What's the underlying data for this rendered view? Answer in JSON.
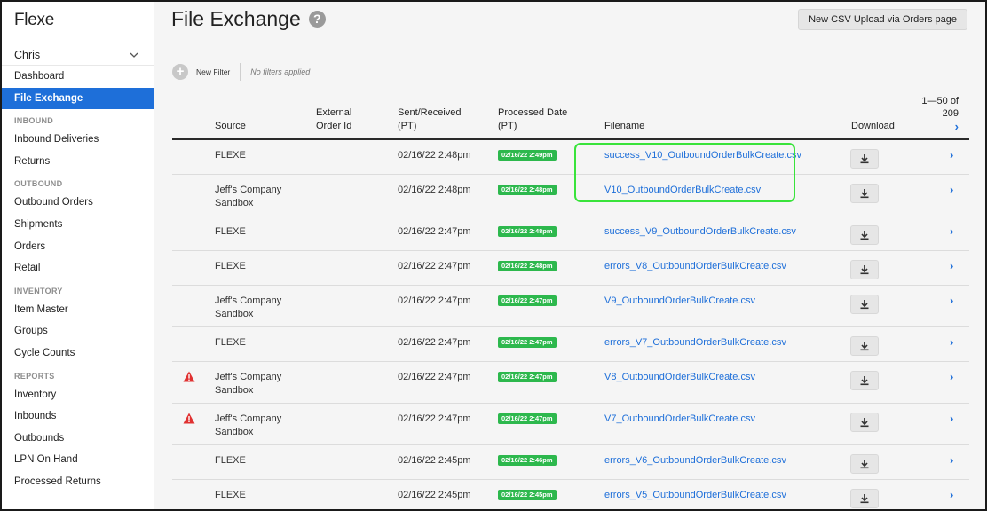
{
  "app": {
    "logo": "Flexe",
    "user": "Chris"
  },
  "sidebar": {
    "top_items": [
      {
        "label": "Dashboard",
        "active": false
      },
      {
        "label": "File Exchange",
        "active": true
      }
    ],
    "sections": [
      {
        "title": "INBOUND",
        "items": [
          "Inbound Deliveries",
          "Returns"
        ]
      },
      {
        "title": "OUTBOUND",
        "items": [
          "Outbound Orders",
          "Shipments",
          "Orders",
          "Retail"
        ]
      },
      {
        "title": "INVENTORY",
        "items": [
          "Item Master",
          "Groups",
          "Cycle Counts"
        ]
      },
      {
        "title": "REPORTS",
        "items": [
          "Inventory",
          "Inbounds",
          "Outbounds",
          "LPN On Hand",
          "Processed Returns"
        ]
      }
    ]
  },
  "header": {
    "title": "File Exchange",
    "help": "?",
    "upload_button": "New CSV Upload via Orders page"
  },
  "filters": {
    "new_filter": "New Filter",
    "status": "No filters applied"
  },
  "table": {
    "columns": {
      "source": "Source",
      "external_order_id": "External Order Id",
      "sent_received": "Sent/Received (PT)",
      "processed_date": "Processed Date (PT)",
      "filename": "Filename",
      "download": "Download"
    },
    "pager": {
      "range": "1—50 of",
      "total": "209",
      "next": "›"
    },
    "rows": [
      {
        "source": "FLEXE",
        "sent": "02/16/22 2:48pm",
        "processed": "02/16/22 2:49pm",
        "filename": "success_V10_OutboundOrderBulkCreate.csv",
        "warning": false
      },
      {
        "source": "Jeff's Company Sandbox",
        "sent": "02/16/22 2:48pm",
        "processed": "02/16/22 2:48pm",
        "filename": "V10_OutboundOrderBulkCreate.csv",
        "warning": false
      },
      {
        "source": "FLEXE",
        "sent": "02/16/22 2:47pm",
        "processed": "02/16/22 2:48pm",
        "filename": "success_V9_OutboundOrderBulkCreate.csv",
        "warning": false
      },
      {
        "source": "FLEXE",
        "sent": "02/16/22 2:47pm",
        "processed": "02/16/22 2:48pm",
        "filename": "errors_V8_OutboundOrderBulkCreate.csv",
        "warning": false
      },
      {
        "source": "Jeff's Company Sandbox",
        "sent": "02/16/22 2:47pm",
        "processed": "02/16/22 2:47pm",
        "filename": "V9_OutboundOrderBulkCreate.csv",
        "warning": false
      },
      {
        "source": "FLEXE",
        "sent": "02/16/22 2:47pm",
        "processed": "02/16/22 2:47pm",
        "filename": "errors_V7_OutboundOrderBulkCreate.csv",
        "warning": false
      },
      {
        "source": "Jeff's Company Sandbox",
        "sent": "02/16/22 2:47pm",
        "processed": "02/16/22 2:47pm",
        "filename": "V8_OutboundOrderBulkCreate.csv",
        "warning": true
      },
      {
        "source": "Jeff's Company Sandbox",
        "sent": "02/16/22 2:47pm",
        "processed": "02/16/22 2:47pm",
        "filename": "V7_OutboundOrderBulkCreate.csv",
        "warning": true
      },
      {
        "source": "FLEXE",
        "sent": "02/16/22 2:45pm",
        "processed": "02/16/22 2:46pm",
        "filename": "errors_V6_OutboundOrderBulkCreate.csv",
        "warning": false
      },
      {
        "source": "FLEXE",
        "sent": "02/16/22 2:45pm",
        "processed": "02/16/22 2:45pm",
        "filename": "errors_V5_OutboundOrderBulkCreate.csv",
        "warning": false
      }
    ]
  },
  "colors": {
    "accent": "#1e6fd9",
    "processed_badge": "#2db84d",
    "warning": "#e03131",
    "highlight": "#39e33b"
  }
}
